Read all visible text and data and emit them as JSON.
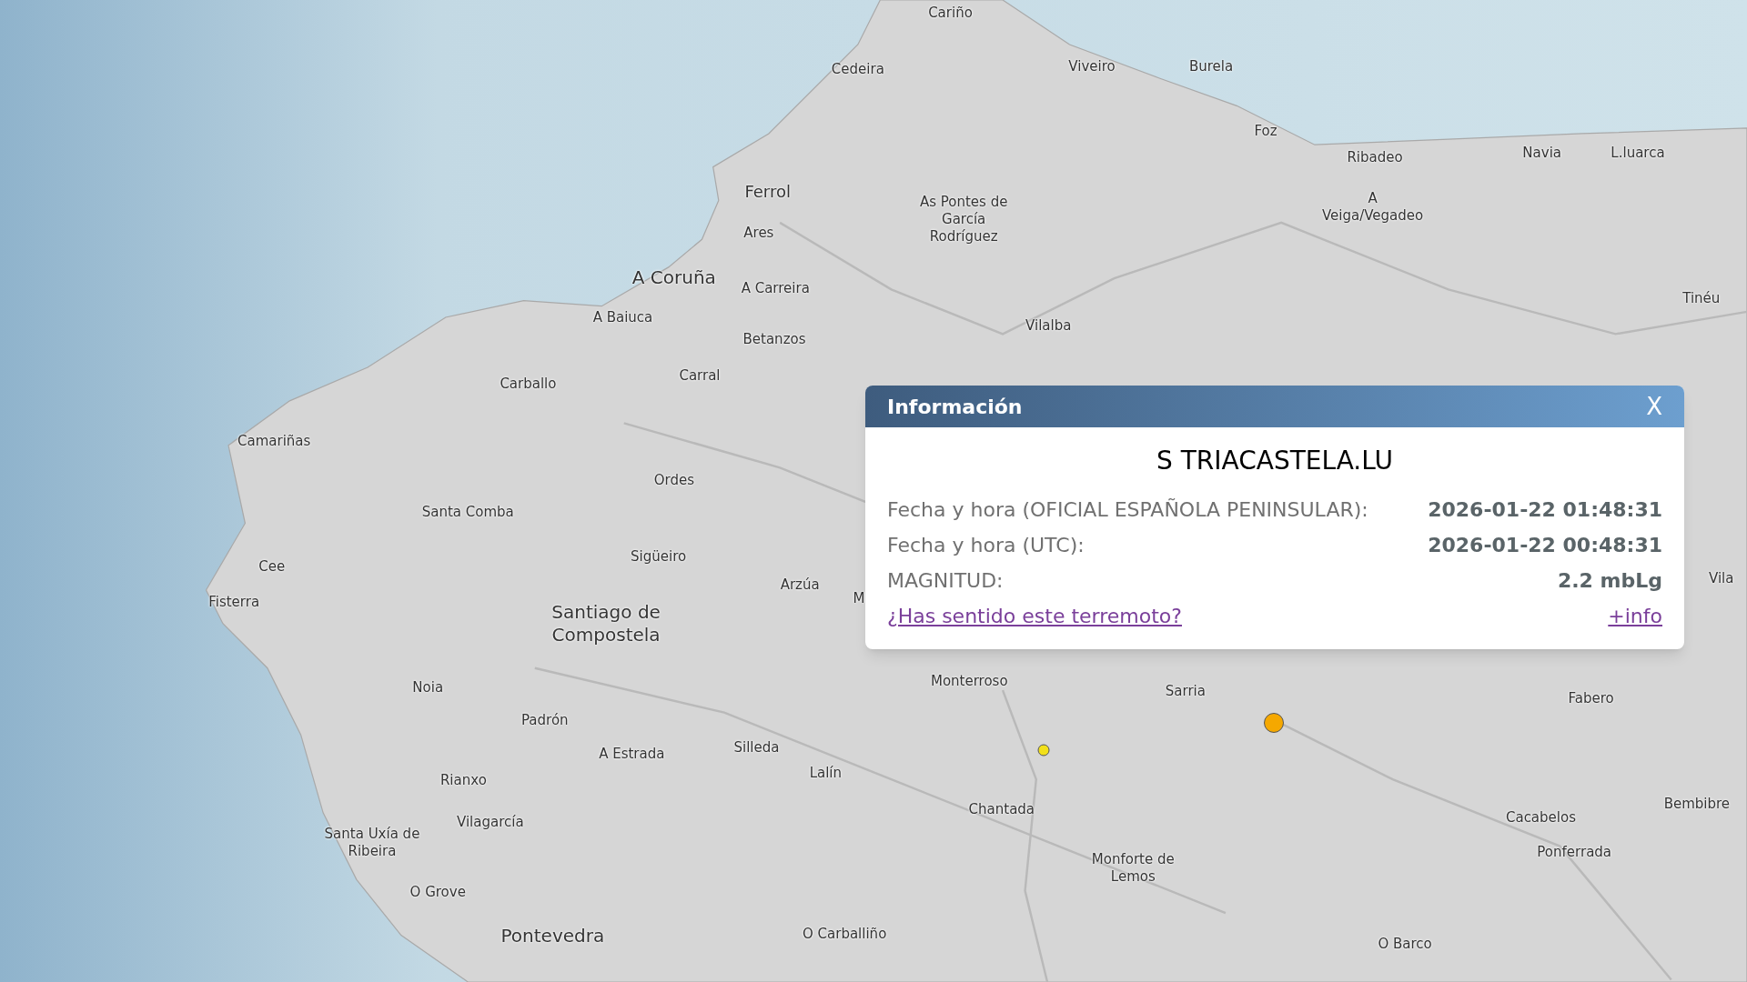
{
  "map": {
    "places": [
      {
        "name": "Cariño",
        "kind": "town"
      },
      {
        "name": "Cedeira",
        "kind": "town"
      },
      {
        "name": "Viveiro",
        "kind": "town"
      },
      {
        "name": "Burela",
        "kind": "town"
      },
      {
        "name": "Foz",
        "kind": "town"
      },
      {
        "name": "Ribadeo",
        "kind": "town"
      },
      {
        "name": "Navia",
        "kind": "town"
      },
      {
        "name": "L.luarca",
        "kind": "town"
      },
      {
        "name": "Ferrol",
        "kind": "major"
      },
      {
        "name": "As Pontes de\nGarcía\nRodríguez",
        "kind": "town"
      },
      {
        "name": "A\nVeiga/Vegadeo",
        "kind": "town"
      },
      {
        "name": "Ares",
        "kind": "town"
      },
      {
        "name": "A Coruña",
        "kind": "city"
      },
      {
        "name": "A Carreira",
        "kind": "town"
      },
      {
        "name": "Tinéu",
        "kind": "town"
      },
      {
        "name": "A Baiuca",
        "kind": "town"
      },
      {
        "name": "Vilalba",
        "kind": "town"
      },
      {
        "name": "Betanzos",
        "kind": "town"
      },
      {
        "name": "Carral",
        "kind": "town"
      },
      {
        "name": "Carballo",
        "kind": "town"
      },
      {
        "name": "Camariñas",
        "kind": "town"
      },
      {
        "name": "Ordes",
        "kind": "town"
      },
      {
        "name": "Santa Comba",
        "kind": "town"
      },
      {
        "name": "Sigüeiro",
        "kind": "town"
      },
      {
        "name": "Cee",
        "kind": "town"
      },
      {
        "name": "Arzúa",
        "kind": "town"
      },
      {
        "name": "Vila",
        "kind": "town"
      },
      {
        "name": "M",
        "kind": "town"
      },
      {
        "name": "Fisterra",
        "kind": "town"
      },
      {
        "name": "Santiago de\nCompostela",
        "kind": "city"
      },
      {
        "name": "Monterroso",
        "kind": "town"
      },
      {
        "name": "Sarria",
        "kind": "town"
      },
      {
        "name": "Noia",
        "kind": "town"
      },
      {
        "name": "Fabero",
        "kind": "town"
      },
      {
        "name": "Padrón",
        "kind": "town"
      },
      {
        "name": "Silleda",
        "kind": "town"
      },
      {
        "name": "A Estrada",
        "kind": "town"
      },
      {
        "name": "Lalín",
        "kind": "town"
      },
      {
        "name": "Rianxo",
        "kind": "town"
      },
      {
        "name": "Bembibre",
        "kind": "town"
      },
      {
        "name": "Chantada",
        "kind": "town"
      },
      {
        "name": "Cacabelos",
        "kind": "town"
      },
      {
        "name": "Vilagarcía",
        "kind": "town"
      },
      {
        "name": "Santa Uxía de\nRibeira",
        "kind": "town"
      },
      {
        "name": "Ponferrada",
        "kind": "town"
      },
      {
        "name": "Monforte de\nLemos",
        "kind": "town"
      },
      {
        "name": "O Grove",
        "kind": "town"
      },
      {
        "name": "Pontevedra",
        "kind": "city"
      },
      {
        "name": "O Carballiño",
        "kind": "town"
      },
      {
        "name": "O Barco",
        "kind": "town"
      }
    ],
    "quakes": [
      {
        "kind": "large",
        "color": "#f5a800"
      },
      {
        "kind": "small",
        "color": "#f2e01a"
      }
    ]
  },
  "popup": {
    "title": "Información",
    "close": "X",
    "location": "S TRIACASTELA.LU",
    "rows": [
      {
        "label": "Fecha y hora (OFICIAL ESPAÑOLA PENINSULAR):",
        "value": "2026-01-22 01:48:31"
      },
      {
        "label": "Fecha y hora (UTC):",
        "value": "2026-01-22 00:48:31"
      },
      {
        "label": "MAGNITUD:",
        "value": "2.2 mbLg"
      }
    ],
    "felt_link": "¿Has sentido este terremoto?",
    "info_link": "+info"
  }
}
